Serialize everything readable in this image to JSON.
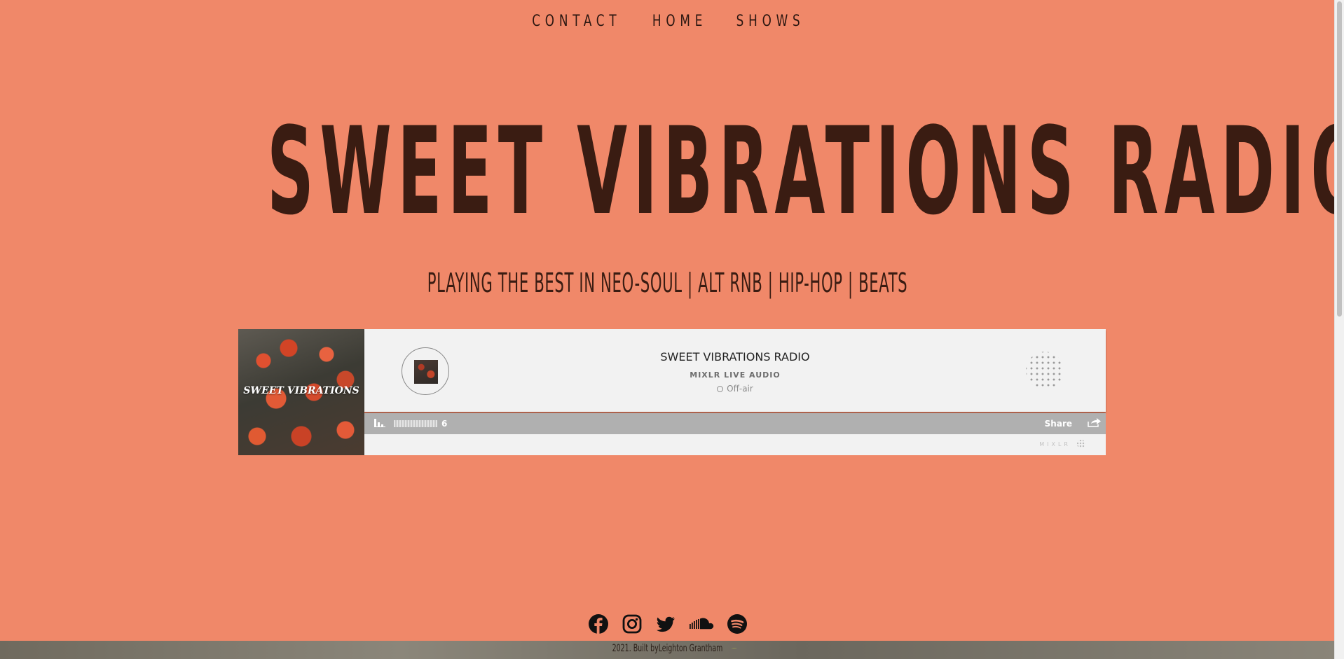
{
  "nav": {
    "items": [
      "CONTACT",
      "HOME",
      "SHOWS"
    ]
  },
  "hero": {
    "title": "SWEET VIBRATIONS RADIO",
    "tagline": "PLAYING THE BEST IN NEO-SOUL | ALT RNB | HIP-HOP | BEATS"
  },
  "player": {
    "art_title": "SWEET VIBRATIONS",
    "station_title": "SWEET VIBRATIONS RADIO",
    "subtitle": "MIXLR LIVE AUDIO",
    "status": "Off-air",
    "listeners": "6",
    "share_label": "Share",
    "brand": "MIXLR"
  },
  "socials": [
    "facebook-icon",
    "instagram-icon",
    "twitter-icon",
    "soundcloud-icon",
    "spotify-icon"
  ],
  "footer": {
    "copyright": "2021. Built byLeighton Grantham"
  },
  "colors": {
    "background": "#f08869",
    "text": "#3a1c12"
  }
}
